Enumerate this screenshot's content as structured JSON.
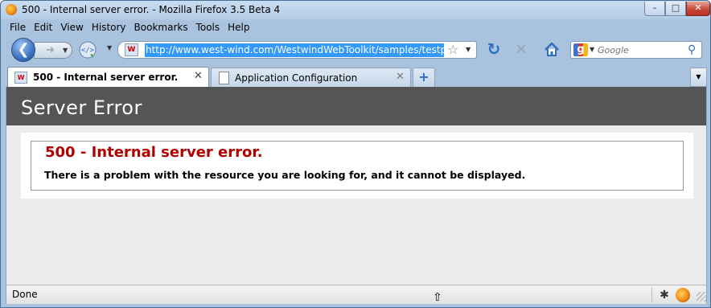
{
  "window": {
    "title": "500 - Internal server error. - Mozilla Firefox 3.5 Beta 4",
    "controls": {
      "minimize": "–",
      "maximize": "□",
      "close": "✕"
    }
  },
  "menu": [
    "File",
    "Edit",
    "View",
    "History",
    "Bookmarks",
    "Tools",
    "Help"
  ],
  "navigation": {
    "url": "http://www.west-wind.com/WestwindWebToolkit/samples/testpage.aspx",
    "search_placeholder": "Google",
    "site_icon": "W"
  },
  "tabs": [
    {
      "label": "500 - Internal server error.",
      "active": true,
      "favicon": "W"
    },
    {
      "label": "Application Configuration",
      "active": false
    }
  ],
  "page": {
    "header_title": "Server Error",
    "error_title": "500 - Internal server error.",
    "error_message": "There is a problem with the resource you are looking for, and it cannot be displayed."
  },
  "status": {
    "text": "Done"
  },
  "colors": {
    "header_bg": "#555555",
    "error_title": "#b00000",
    "content_bg": "#ececec",
    "url_selection": "#3399ff"
  },
  "icons": {
    "back": "back-arrow-icon",
    "forward": "forward-arrow-icon",
    "reload": "reload-icon",
    "bookmark": "star-icon",
    "refresh": "refresh-icon",
    "stop": "stop-icon",
    "home": "home-icon",
    "search": "magnifier-icon",
    "new_tab": "plus-icon"
  }
}
